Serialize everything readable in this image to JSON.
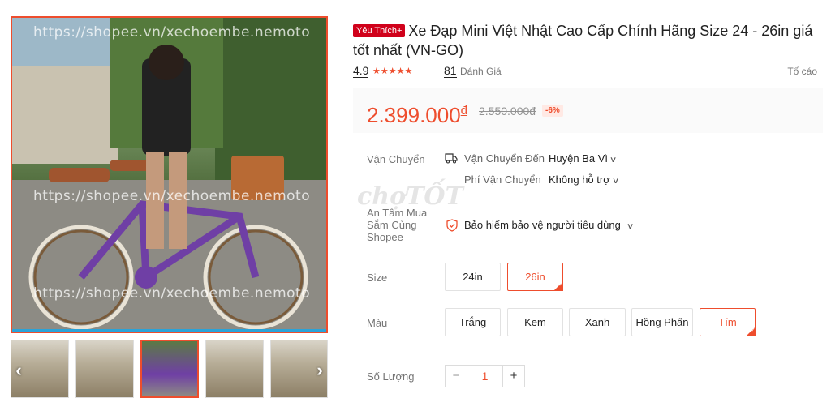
{
  "gallery": {
    "watermark": "https://shopee.vn/xechoembe.nemoto",
    "watermark_top": "https://shopee.vn/xechoembe.nemoto",
    "prev_icon": "chevron-left-icon",
    "next_icon": "chevron-right-icon"
  },
  "product": {
    "badge": "Yêu Thích+",
    "title": "Xe Đạp Mini Việt Nhật Cao Cấp Chính Hãng Size 24 - 26in giá tốt nhất (VN-GO)"
  },
  "rating": {
    "score": "4.9",
    "stars": "★★★★★",
    "star_value": 4.9,
    "review_count": "81",
    "review_label": "Đánh Giá",
    "report_label": "Tố cáo"
  },
  "price": {
    "current": "2.399.000",
    "currency": "đ",
    "original": "2.550.000đ",
    "discount": "-6%"
  },
  "shipping": {
    "label": "Vận Chuyển",
    "to_label": "Vận Chuyển Đến",
    "to_value": "Huyện Ba Vì",
    "fee_label": "Phí Vận Chuyển",
    "fee_value": "Không hỗ trợ"
  },
  "assurance": {
    "label_line1": "An Tâm Mua",
    "label_line2": "Sắm Cùng",
    "label_line3": "Shopee",
    "value": "Bảo hiểm bảo vệ người tiêu dùng"
  },
  "size": {
    "label": "Size",
    "options": [
      "24in",
      "26in"
    ],
    "selected": "26in"
  },
  "color": {
    "label": "Màu",
    "options": [
      "Trắng",
      "Kem",
      "Xanh",
      "Hồng Phấn",
      "Tím"
    ],
    "selected": "Tím"
  },
  "quantity": {
    "label": "Số Lượng",
    "minus": "−",
    "value": "1",
    "plus": "+"
  },
  "overlay_watermark": "chợTỐT",
  "colors": {
    "accent": "#ee4d2d",
    "badge": "#d0011b"
  }
}
